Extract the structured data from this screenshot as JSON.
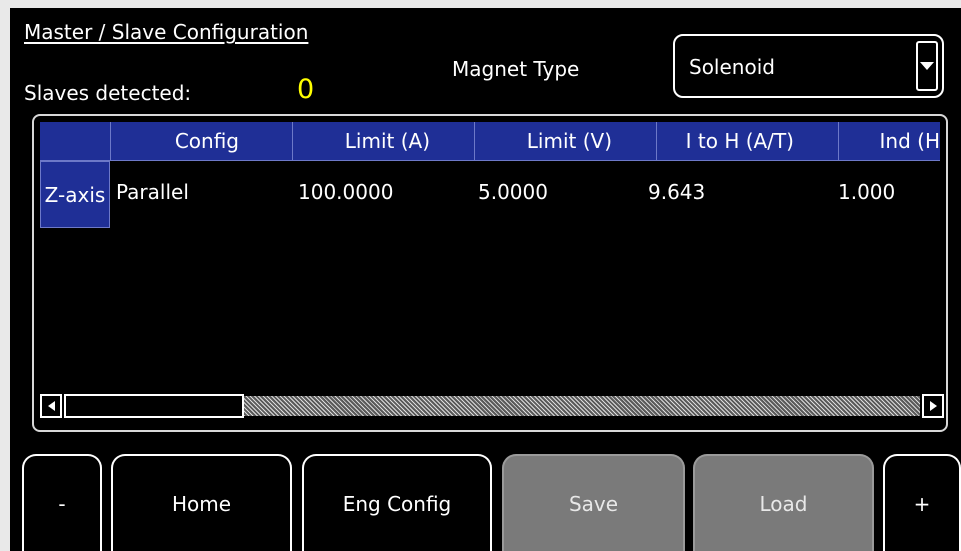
{
  "header": {
    "title": "Master / Slave Configuration",
    "slaves_label": "Slaves detected:",
    "slaves_count": "0",
    "magnet_type_label": "Magnet Type",
    "magnet_type_value": "Solenoid"
  },
  "table": {
    "columns": [
      "",
      "Config",
      "Limit (A)",
      "Limit (V)",
      "I to H (A/T)",
      "Ind (H"
    ],
    "rows": [
      {
        "label": "Z-axis",
        "cells": [
          "Parallel",
          "100.0000",
          "5.0000",
          "9.643",
          "1.000"
        ]
      }
    ]
  },
  "buttons": {
    "minus": "-",
    "home": "Home",
    "eng_config": "Eng Config",
    "save": "Save",
    "load": "Load",
    "plus": "+"
  },
  "colors": {
    "background": "#000000",
    "header_blue": "#1f2f96",
    "count_yellow": "#ffff00",
    "disabled_gray": "#7a7a7a"
  }
}
